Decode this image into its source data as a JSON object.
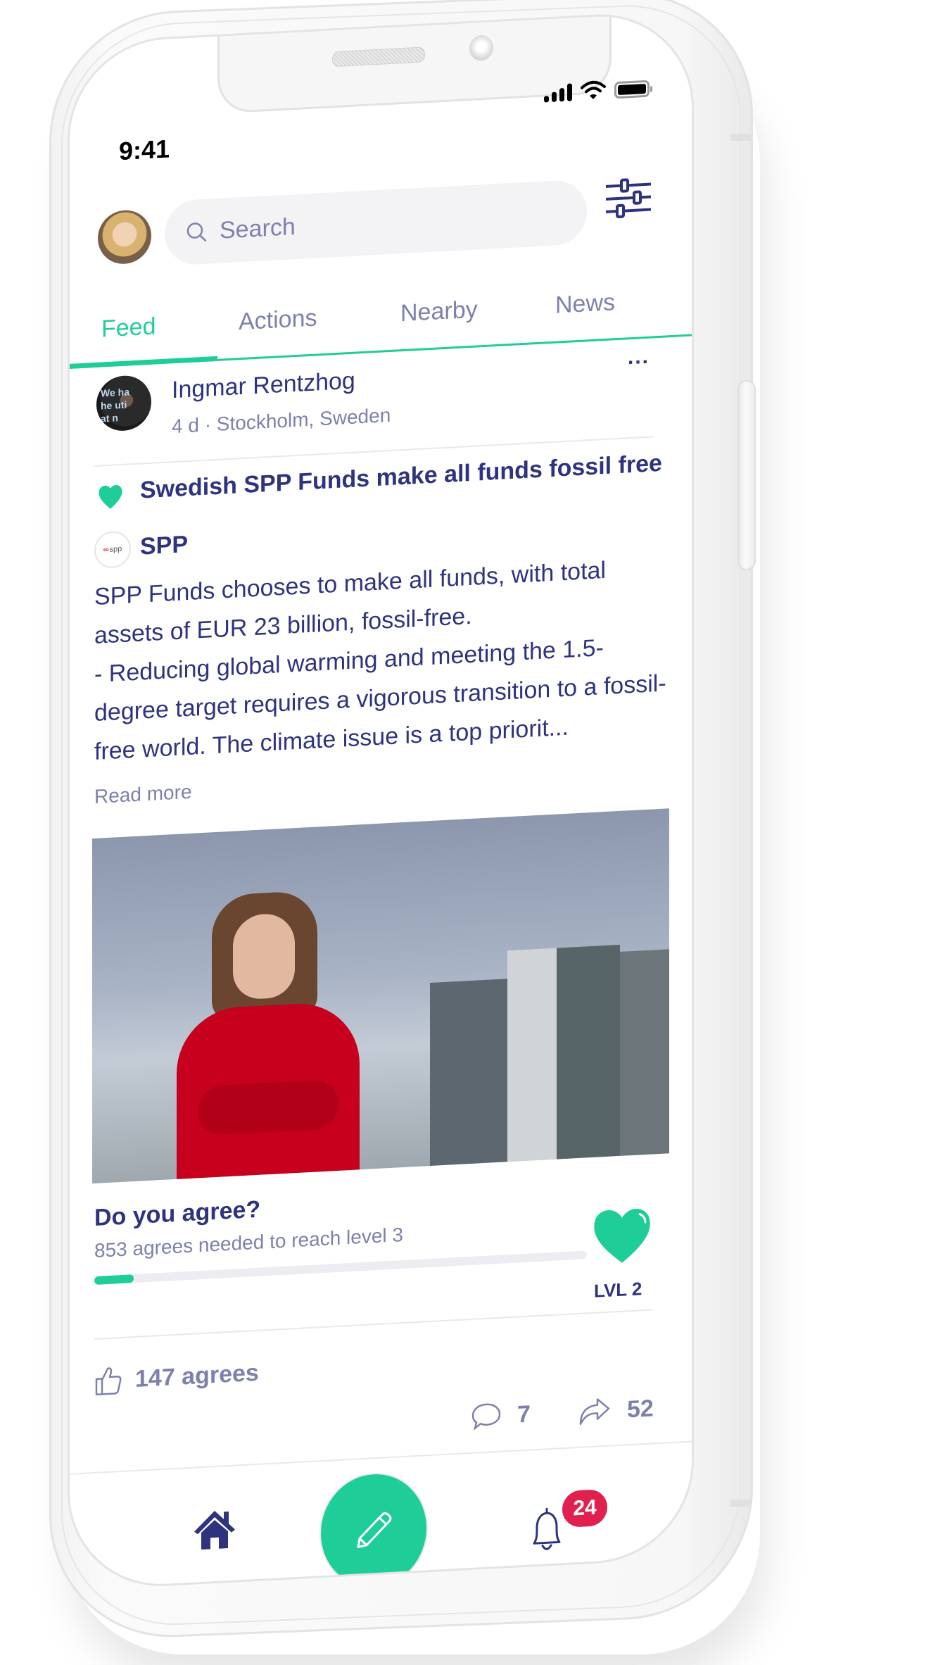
{
  "status_bar": {
    "time": "9:41",
    "icons": [
      "signal-icon",
      "wifi-icon",
      "battery-icon"
    ]
  },
  "header": {
    "search": {
      "placeholder": "Search"
    },
    "icons": {
      "avatar": "user-avatar",
      "filter": "sliders-icon"
    }
  },
  "tabs": [
    {
      "label": "Feed",
      "active": true
    },
    {
      "label": "Actions",
      "active": false
    },
    {
      "label": "Nearby",
      "active": false
    },
    {
      "label": "News",
      "active": false
    }
  ],
  "post": {
    "more_label": "...",
    "author": {
      "name": "Ingmar Rentzhog",
      "meta": "4 d · Stockholm, Sweden"
    },
    "title": "Swedish SPP Funds make all funds fossil free",
    "source": {
      "name": "SPP",
      "logo_text": "spp"
    },
    "body": "SPP Funds chooses to make all funds, with total assets of EUR 23 billion, fossil-free.\n- Reducing global warming and meeting the 1.5-degree target requires a vigorous transition to a fossil-free world. The climate issue is a top priorit...",
    "read_more": "Read more",
    "agree": {
      "question": "Do you agree?",
      "subtitle": "853 agrees needed to reach level 3",
      "progress_fraction": 0.08,
      "level_label": "LVL 2"
    },
    "stats": {
      "agrees": "147 agrees",
      "comments": "7",
      "shares": "52"
    }
  },
  "nav": {
    "items": [
      "home-icon",
      "compose-button",
      "notifications-icon"
    ],
    "notification_badge": "24"
  },
  "colors": {
    "accent": "#1ECD97",
    "text_primary": "#2E3380",
    "text_secondary": "#7E80AD",
    "badge": "#E0204D"
  }
}
